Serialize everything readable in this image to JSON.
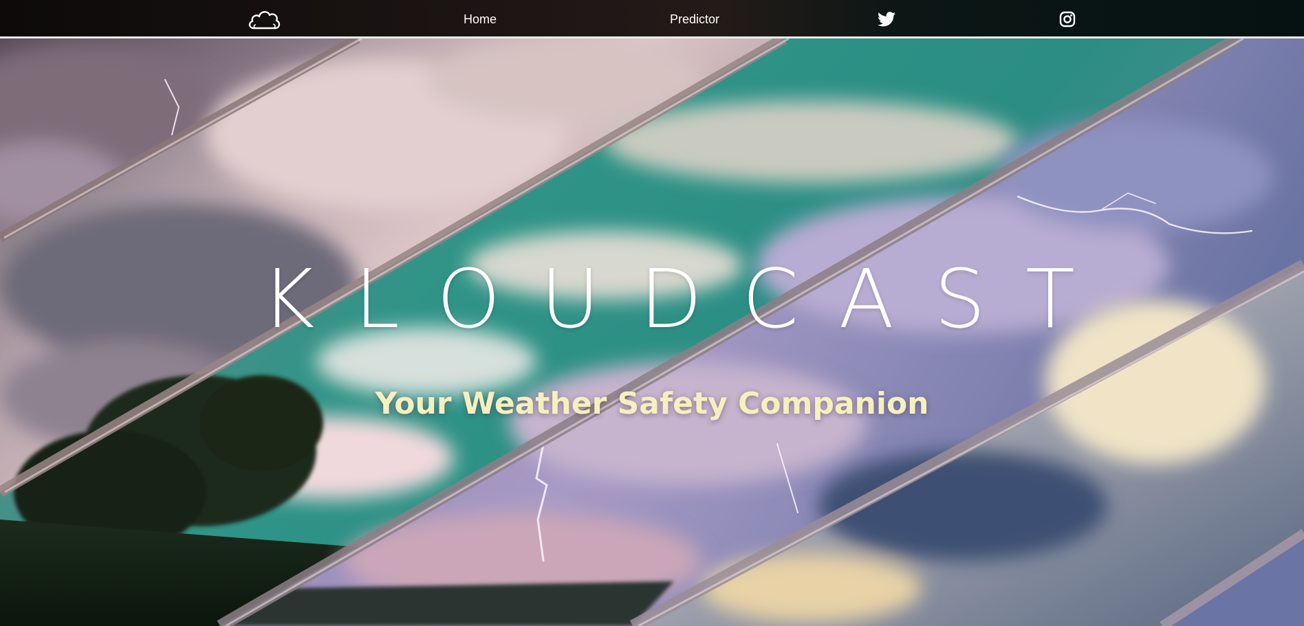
{
  "nav": {
    "logo_icon": "cloud-icon",
    "home_label": "Home",
    "predictor_label": "Predictor",
    "twitter_icon": "twitter-icon",
    "instagram_icon": "instagram-icon"
  },
  "hero": {
    "title": "KLOUDCAST",
    "subtitle": "Your Weather Safety Companion"
  },
  "colors": {
    "navbar_bg": "#120d0c",
    "nav_text": "#ffffff",
    "title_text": "#ffffff",
    "subtitle_text": "#f6f0bd",
    "stripe_teal": "#2f9487",
    "stripe_lavender": "#a79bc6"
  }
}
